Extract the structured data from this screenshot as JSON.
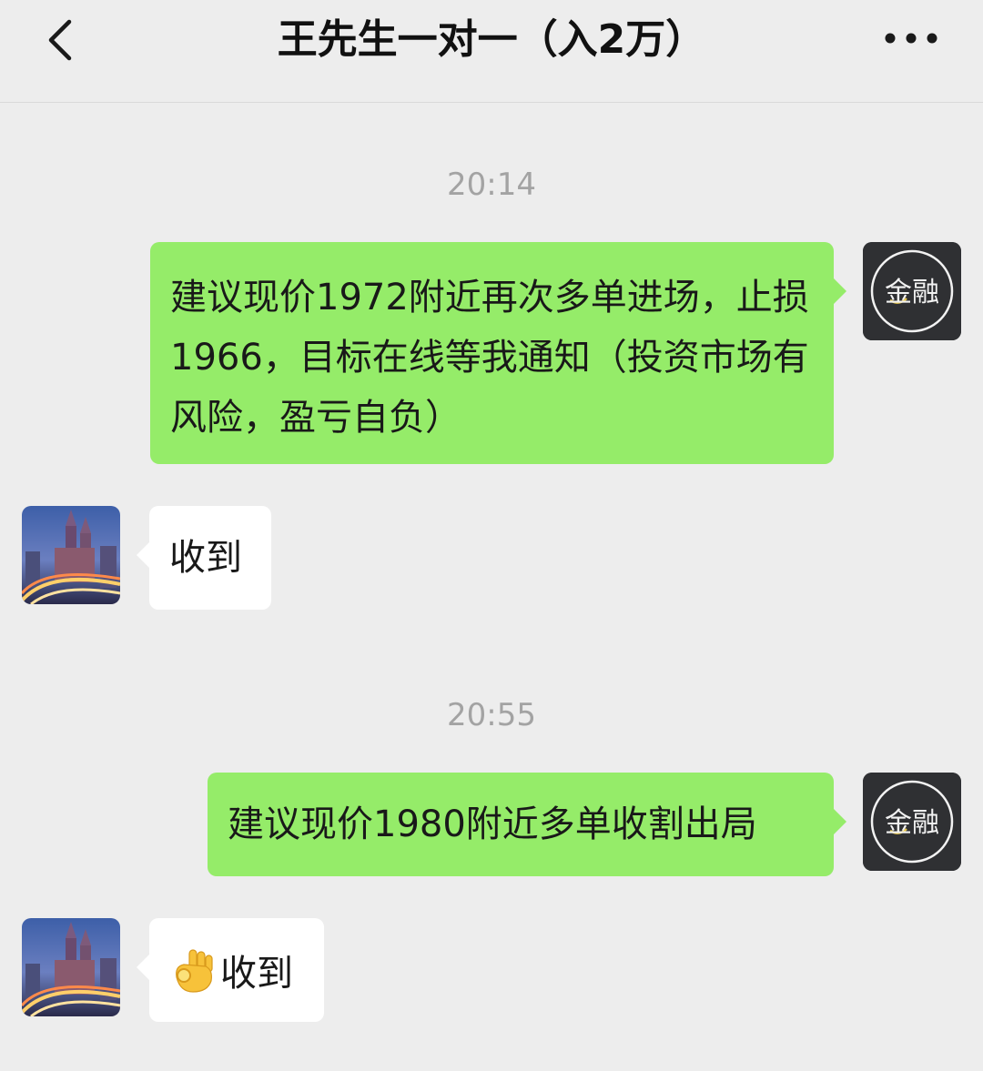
{
  "header": {
    "title": "王先生一对一（入2万）",
    "back_icon": "chevron-left-icon",
    "more_icon": "more-dots-icon"
  },
  "self_avatar": {
    "label": "金融",
    "background": "#2f3033",
    "text_color": "#ffffff",
    "accent": "#e8c64a"
  },
  "messages": [
    {
      "type": "timestamp",
      "text": "20:14"
    },
    {
      "type": "sent",
      "text": "建议现价1972附近再次多单进场，止损1966，目标在线等我通知（投资市场有风险，盈亏自负）"
    },
    {
      "type": "received",
      "text": "收到"
    },
    {
      "type": "timestamp",
      "text": "20:55"
    },
    {
      "type": "sent",
      "text": "建议现价1980附近多单收割出局"
    },
    {
      "type": "received",
      "emoji": "ok-hand-emoji",
      "text": "收到"
    }
  ],
  "colors": {
    "page_background": "#ededed",
    "sent_bubble": "#95ec69",
    "received_bubble": "#ffffff",
    "timestamp_text": "#a3a3a3",
    "message_text": "#191919"
  }
}
